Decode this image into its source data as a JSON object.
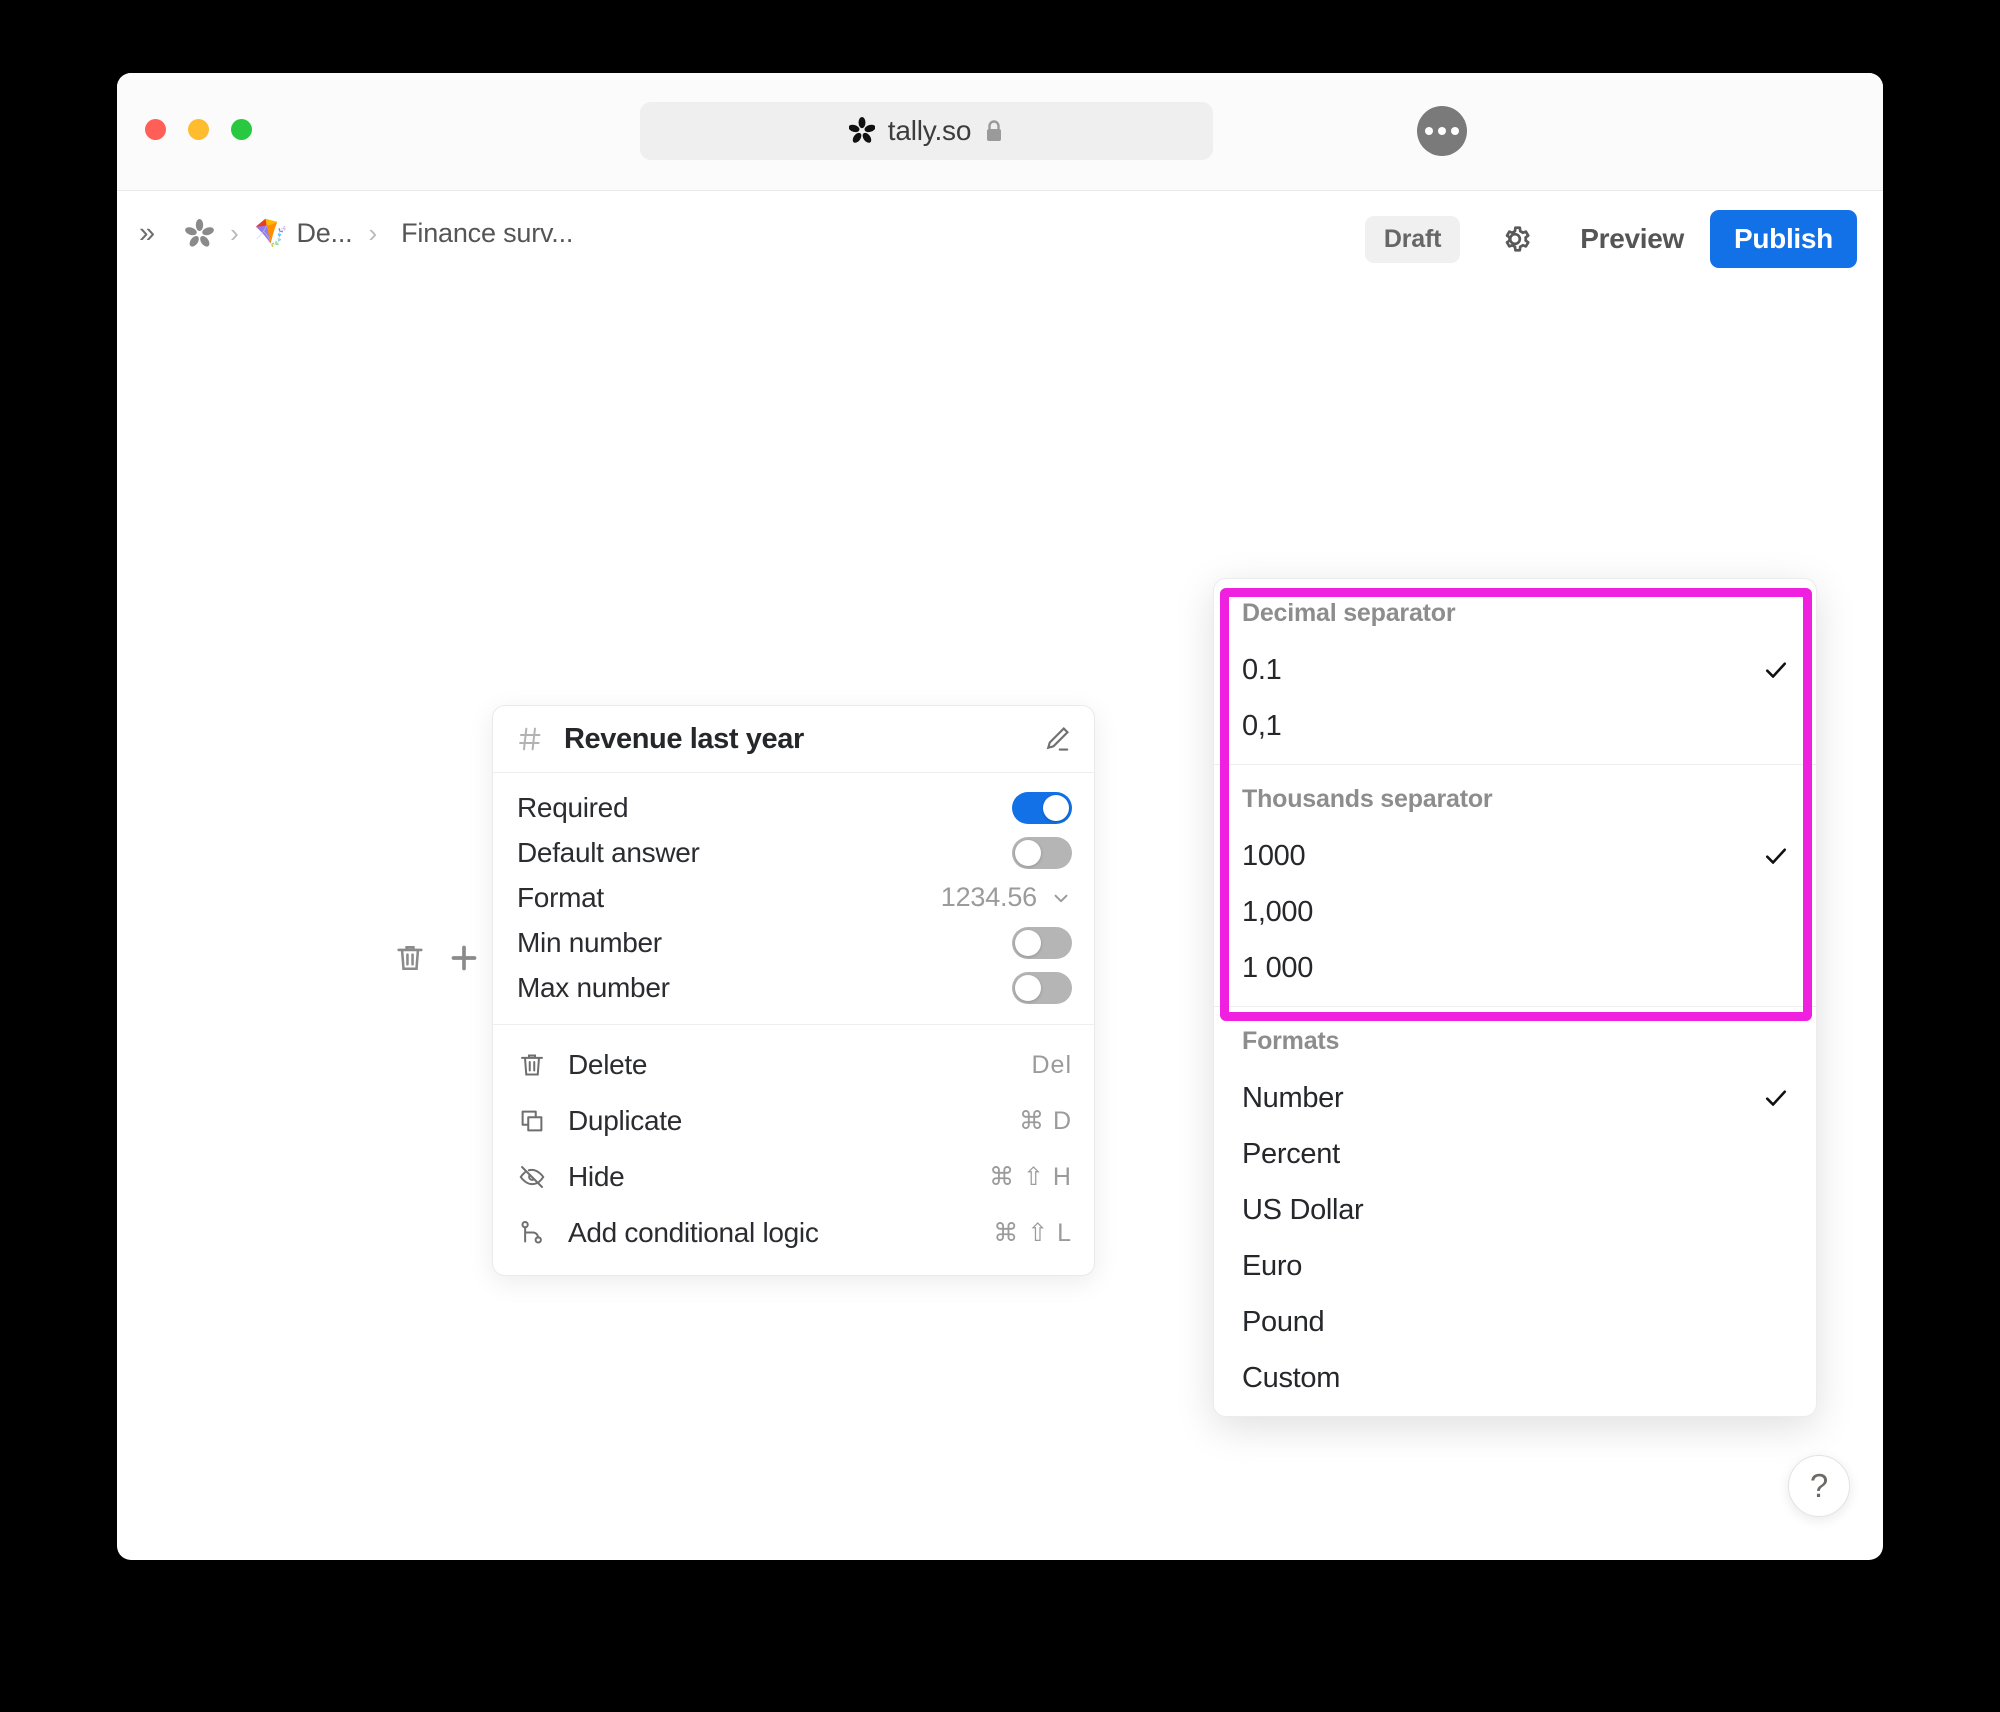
{
  "browser": {
    "url": "tally.so",
    "lock_icon": "lock-icon",
    "site_icon": "tally-asterisk-icon",
    "more_button": "ellipsis-icon"
  },
  "header": {
    "expand_icon": "double-chevron-right-icon",
    "breadcrumb": [
      {
        "icon": "tally-asterisk-icon",
        "label": ""
      },
      {
        "icon": "kite-emoji",
        "label": "De..."
      },
      {
        "icon": "",
        "label": "Finance surv..."
      }
    ],
    "separator": "›",
    "expand_glyph": "»",
    "kite_glyph": "🪁",
    "status_badge": "Draft",
    "settings_icon": "gear-icon",
    "preview_label": "Preview",
    "publish_label": "Publish",
    "publish_color": "#1271e6"
  },
  "block_controls": {
    "delete_icon": "trash-icon",
    "add_icon": "plus-icon",
    "drag_icon": "drag-handle-icon"
  },
  "card": {
    "type_icon": "hash-icon",
    "title": "Revenue last year",
    "edit_icon": "pencil-icon",
    "settings": [
      {
        "label": "Required",
        "control": "toggle",
        "value": "on"
      },
      {
        "label": "Default answer",
        "control": "toggle",
        "value": "off"
      },
      {
        "label": "Format",
        "control": "select",
        "value": "1234.56",
        "chevron": "chevron-down-icon"
      },
      {
        "label": "Min number",
        "control": "toggle",
        "value": "off"
      },
      {
        "label": "Max number",
        "control": "toggle",
        "value": "off"
      }
    ],
    "actions": [
      {
        "icon": "trash-icon",
        "label": "Delete",
        "shortcut": "Del"
      },
      {
        "icon": "copy-icon",
        "label": "Duplicate",
        "shortcut": "⌘ D"
      },
      {
        "icon": "eye-off-icon",
        "label": "Hide",
        "shortcut": "⌘ ⇧ H"
      },
      {
        "icon": "branch-icon",
        "label": "Add conditional logic",
        "shortcut": "⌘ ⇧ L"
      }
    ]
  },
  "format_dropdown": {
    "sections": [
      {
        "title": "Decimal separator",
        "items": [
          {
            "label": "0.1",
            "checked": true
          },
          {
            "label": "0,1",
            "checked": false
          }
        ]
      },
      {
        "title": "Thousands separator",
        "items": [
          {
            "label": "1000",
            "checked": true
          },
          {
            "label": "1,000",
            "checked": false
          },
          {
            "label": "1 000",
            "checked": false
          }
        ]
      },
      {
        "title": "Formats",
        "items": [
          {
            "label": "Number",
            "checked": true
          },
          {
            "label": "Percent",
            "checked": false
          },
          {
            "label": "US Dollar",
            "checked": false
          },
          {
            "label": "Euro",
            "checked": false
          },
          {
            "label": "Pound",
            "checked": false
          },
          {
            "label": "Custom",
            "checked": false
          }
        ]
      }
    ],
    "highlight_color": "#f020e0",
    "check_glyph": "✓"
  },
  "help": {
    "label": "?"
  }
}
